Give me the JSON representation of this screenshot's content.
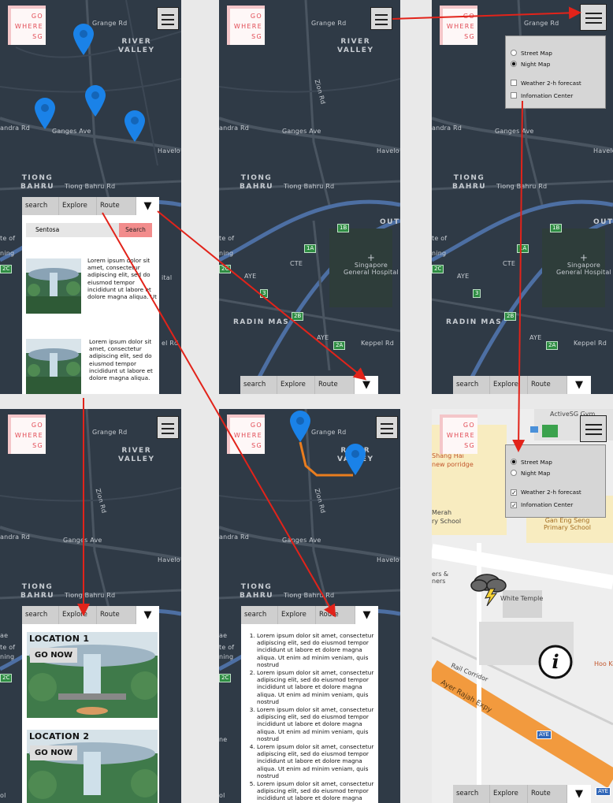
{
  "logo_lines": [
    "GO",
    "WHERE",
    "SG"
  ],
  "tabs": {
    "search": "search",
    "explore": "Explore",
    "route": "Route",
    "dropdown_glyph": "▼"
  },
  "search_panel": {
    "input_value": "Sentosa",
    "button_label": "Search"
  },
  "lorem_short": "Lorem ipsum dolor sit amet, consectetur adipiscing elit, sed do eiusmod tempor incididunt ut labore et dolore magna aliqua. Ut",
  "lorem_short_2": "Lorem ipsum dolor sit amet, consectetur adipiscing elit, sed do eiusmod tempor incididunt ut labore et dolore magna aliqua.",
  "route_steps": [
    "Lorem ipsum dolor sit amet, consectetur adipiscing elit, sed do eiusmod tempor incididunt ut labore et dolore magna aliqua. Ut enim ad minim veniam, quis nostrud",
    "Lorem ipsum dolor sit amet, consectetur adipiscing elit, sed do eiusmod tempor incididunt ut labore et dolore magna aliqua. Ut enim ad minim veniam, quis nostrud",
    "Lorem ipsum dolor sit amet, consectetur adipiscing elit, sed do eiusmod tempor incididunt ut labore et dolore magna aliqua. Ut enim ad minim veniam, quis nostrud",
    "Lorem ipsum dolor sit amet, consectetur adipiscing elit, sed do eiusmod tempor incididunt ut labore et dolore magna aliqua. Ut enim ad minim veniam, quis nostrud",
    "Lorem ipsum dolor sit amet, consectetur adipiscing elit, sed do eiusmod tempor incididunt ut labore et dolore magna aliqua. Ut enim ad minim veniam, quis nostrud"
  ],
  "locations": [
    {
      "title": "LOCATION 1",
      "button": "GO NOW"
    },
    {
      "title": "LOCATION 2",
      "button": "GO NOW"
    }
  ],
  "menu": {
    "street_map": "Street Map",
    "night_map": "Night Map",
    "weather": "Weather 2-h forecast",
    "info_center": "Infomation Center"
  },
  "map_labels": {
    "grange_rd": "Grange Rd",
    "river_valley": "RIVER\nVALLEY",
    "zion_rd": "Zion Rd",
    "ganges_ave": "Ganges Ave",
    "kandra_rd": "andra Rd",
    "havelock": "Havelo",
    "tiong_bahru": "TIONG\nBAHRU",
    "tiong_bahru_rd": "Tiong Bahru Rd",
    "outram": "OUTR",
    "cte": "CTE",
    "aye": "AYE",
    "radin_mas": "RADIN MAS",
    "keppel_rd": "Keppel Rd",
    "sgh": "Singapore\nGeneral Hospital",
    "ae": "ae",
    "ol": "ol",
    "ning": "ning",
    "te_of": "te of",
    "ital": "ital",
    "ne": "ne",
    "el_rd": "el Rd"
  },
  "badges": {
    "b1b": "1B",
    "b1a": "1A",
    "b2c": "2C",
    "b3": "3",
    "b2b": "2B",
    "b2a": "2A"
  },
  "street_labels": {
    "activesg": "ActiveSG Gym",
    "shang_hai": "Shang Hai",
    "porridge": "new porridge",
    "merah": "Merah",
    "ry_school": "ry School",
    "gan_eng_seng": "Gan Eng Seng\nPrimary School",
    "ers": "ers &\nners",
    "white_temple": "White Temple",
    "hoo_kee": "Hoo Kee Bak",
    "rail_corridor": "Rail Corridor",
    "ayer_rajah": "Ayer Rajah Expy",
    "aye_badge": "AYE",
    "aye_badge2": "AYE"
  },
  "colors": {
    "map_bg": "#2f3a46",
    "road": "#4a5561",
    "expressway": "#4d6fa3",
    "pin": "#1a82e8",
    "route_line": "#e97d1f",
    "arrow": "#e2231a",
    "logo_bg": "#f4c6c9",
    "logo_text": "#e24b55"
  }
}
